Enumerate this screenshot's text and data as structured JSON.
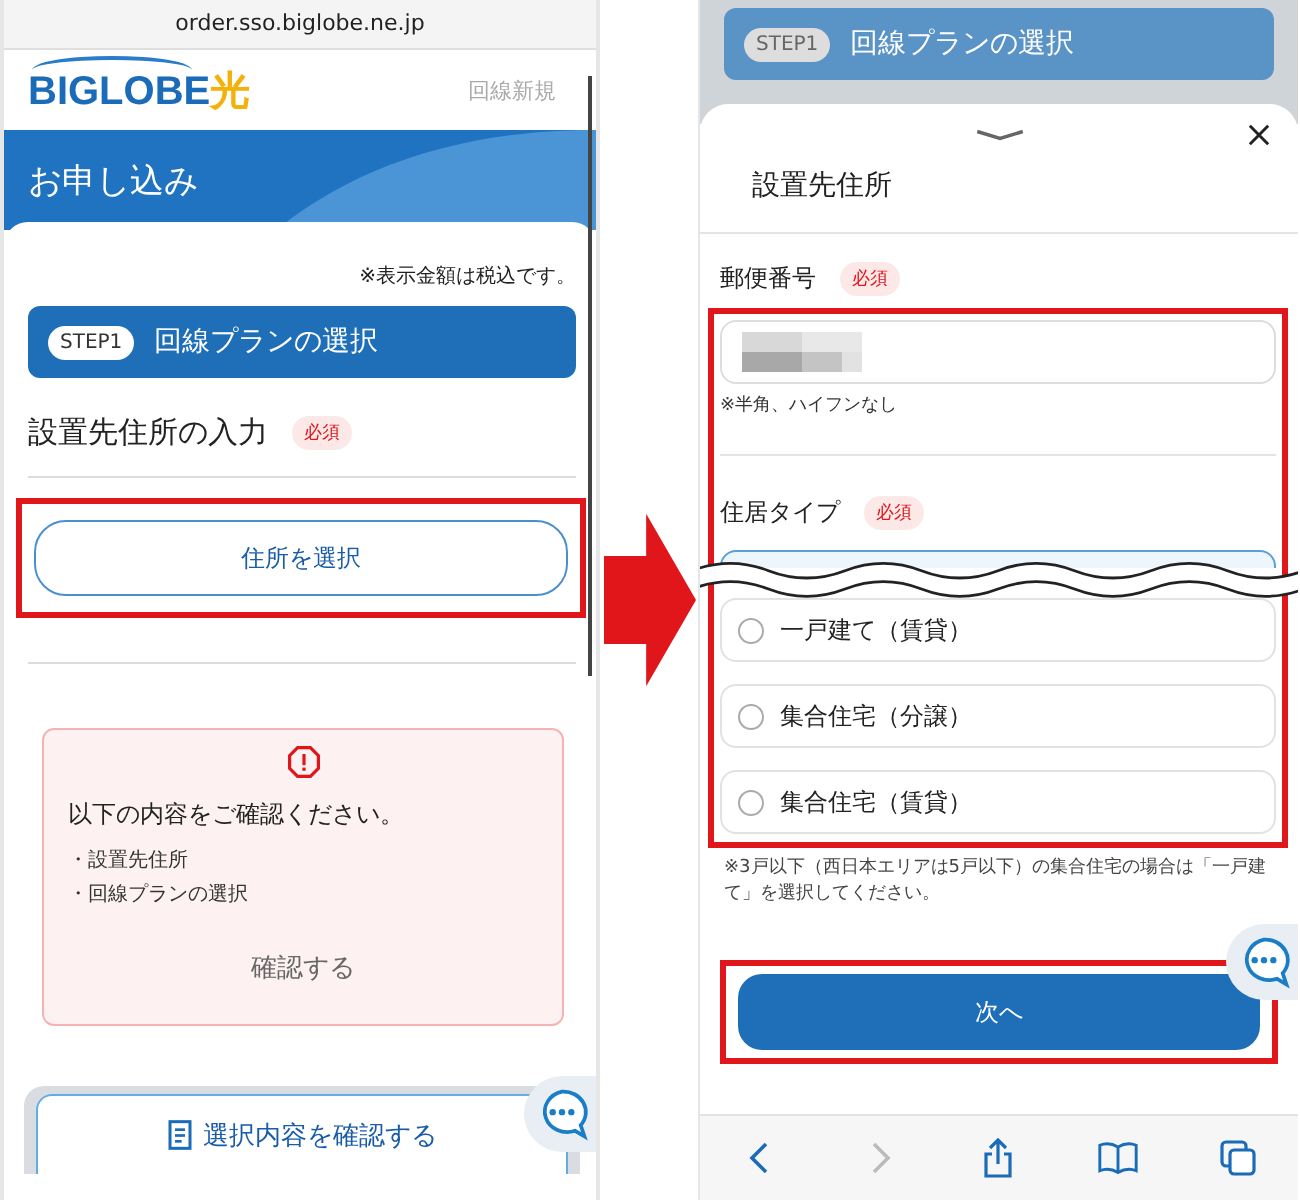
{
  "left_screen": {
    "address_bar": "order.sso.biglobe.ne.jp",
    "logo": {
      "text": "BIGLOBE",
      "accent": "光"
    },
    "header_link": "回線新規",
    "banner_title": "お申し込み",
    "tax_note": "※表示金額は税込です。",
    "step": {
      "badge": "STEP1",
      "title": "回線プランの選択"
    },
    "section": {
      "title": "設置先住所の入力",
      "badge": "必須"
    },
    "select_button": {
      "label": "住所を選択",
      "highlighted": true
    },
    "alert": {
      "title": "以下の内容をご確認ください。",
      "items": [
        "・設置先住所",
        "・回線プランの選択"
      ],
      "action": "確認する"
    },
    "confirm_button": "選択内容を確認する"
  },
  "right_screen": {
    "background_step": {
      "badge": "STEP1",
      "title": "回線プランの選択"
    },
    "sheet": {
      "title": "設置先住所",
      "form": {
        "highlighted": true,
        "postal": {
          "label": "郵便番号",
          "badge": "必須",
          "hint": "※半角、ハイフンなし"
        },
        "residence": {
          "label": "住居タイプ",
          "badge": "必須",
          "options": [
            {
              "selected": true
            },
            {
              "label": "一戸建て（賃貸）",
              "selected": false
            },
            {
              "label": "集合住宅（分譲）",
              "selected": false
            },
            {
              "label": "集合住宅（賃貸）",
              "selected": false
            }
          ]
        }
      },
      "note": "※3戸以下（西日本エリアは5戸以下）の集合住宅の場合は「一戸建て」を選択してください。",
      "next_button": {
        "label": "次へ",
        "highlighted": true
      }
    }
  }
}
